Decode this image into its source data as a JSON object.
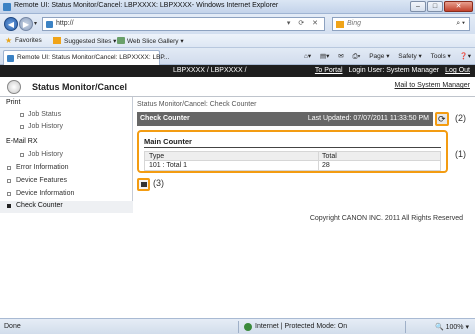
{
  "browser": {
    "window_title": "Remote UI: Status Monitor/Cancel: LBPXXXX: LBPXXXX- Windows Internet Explorer",
    "address": "http://",
    "search_placeholder": "Bing",
    "favorites_label": "Favorites",
    "suggested_sites": "Suggested Sites ▾",
    "web_slice": "Web Slice Gallery ▾",
    "tab_title": "Remote UI: Status Monitor/Cancel: LBPXXXX: LBP...",
    "commands": [
      "Page ▾",
      "Safety ▾",
      "Tools ▾",
      "❓▾"
    ],
    "status_done": "Done",
    "status_zone": "Internet | Protected Mode: On",
    "zoom": "🔍 100% ▾"
  },
  "header": {
    "device_name": "LBPXXXX / LBPXXXX /",
    "to_portal": "To Portal",
    "login_user": "Login User: System Manager",
    "logout": "Log Out",
    "app_title": "Status Monitor/Cancel",
    "mail_link": "Mail to System Manager"
  },
  "sidebar": {
    "items": [
      {
        "label": "Print",
        "kind": "section"
      },
      {
        "label": "Job Status",
        "kind": "item"
      },
      {
        "label": "Job History",
        "kind": "item"
      },
      {
        "label": "E-Mail RX",
        "kind": "section"
      },
      {
        "label": "Job History",
        "kind": "item"
      },
      {
        "label": "Error Information",
        "kind": "link"
      },
      {
        "label": "Device Features",
        "kind": "link"
      },
      {
        "label": "Device Information",
        "kind": "link"
      },
      {
        "label": "Check Counter",
        "kind": "link",
        "active": true
      }
    ]
  },
  "main": {
    "breadcrumb": "Status Monitor/Cancel: Check Counter",
    "page_title": "Check Counter",
    "last_updated": "Last Updated: 07/07/2011 11:33:50 PM",
    "counter_title": "Main Counter",
    "columns": [
      "Type",
      "Total"
    ],
    "rows": [
      {
        "type": "101 : Total 1",
        "total": "28"
      }
    ],
    "callouts": [
      "(1)",
      "(2)",
      "(3)"
    ],
    "copyright": "Copyright CANON INC. 2011 All Rights Reserved"
  }
}
